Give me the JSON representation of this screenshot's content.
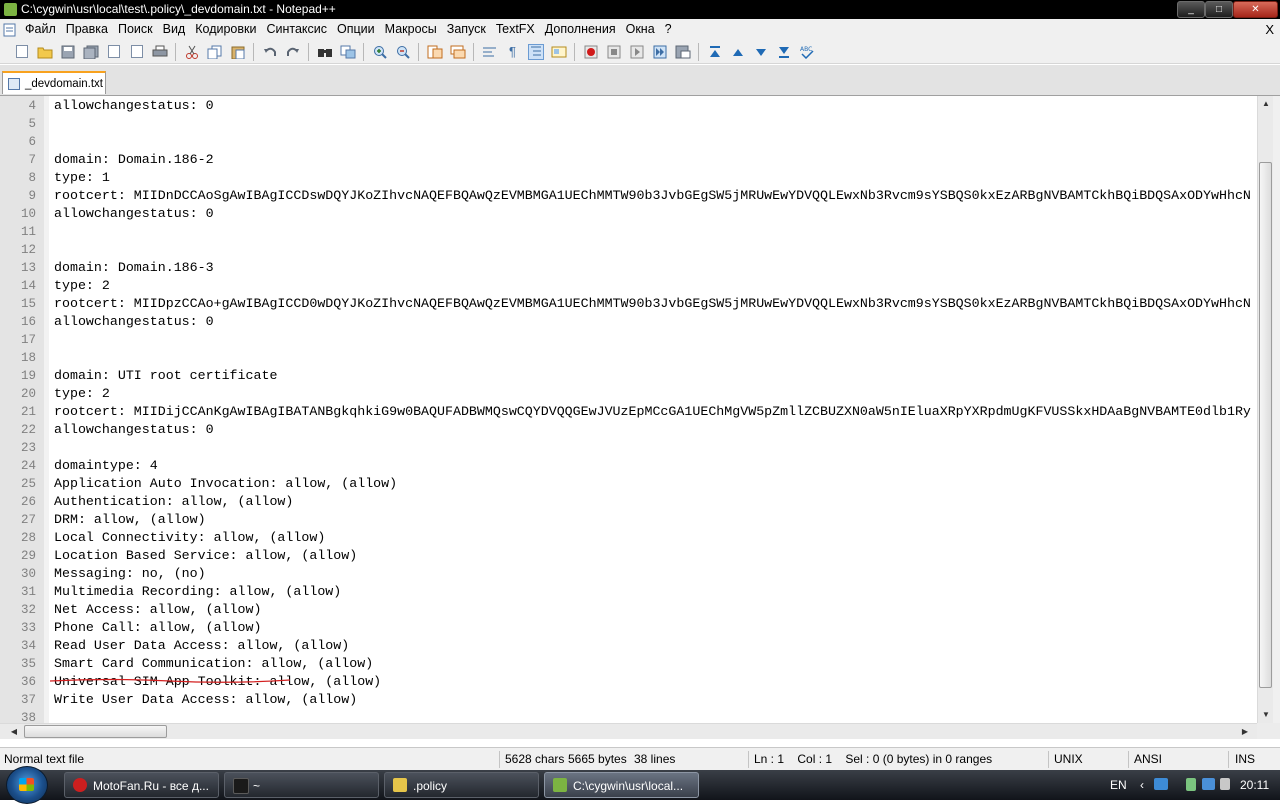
{
  "window": {
    "title": "C:\\cygwin\\usr\\local\\test\\.policy\\_devdomain.txt - Notepad++",
    "controls": [
      "_",
      "□",
      "✕"
    ]
  },
  "menu": {
    "items": [
      "Файл",
      "Правка",
      "Поиск",
      "Вид",
      "Кодировки",
      "Синтаксис",
      "Опции",
      "Макросы",
      "Запуск",
      "TextFX",
      "Дополнения",
      "Окна",
      "?"
    ],
    "close": "X"
  },
  "toolbar": {
    "icons": [
      "new-file-icon",
      "open-file-icon",
      "save-icon",
      "save-all-icon",
      "close-icon",
      "close-all-icon",
      "print-icon",
      "cut-icon",
      "copy-icon",
      "paste-icon",
      "undo-icon",
      "redo-icon",
      "find-icon",
      "replace-icon",
      "zoom-in-icon",
      "zoom-out-icon",
      "sync-vertical-icon",
      "sync-horizontal-icon",
      "word-wrap-icon",
      "show-all-chars-icon",
      "indent-guide-icon",
      "view-doc-icon",
      "record-macro-icon",
      "stop-record-icon",
      "play-macro-icon",
      "run-macro-multiple-icon",
      "save-macro-icon",
      "textfx-first-icon",
      "textfx-up-icon",
      "textfx-down-icon",
      "textfx-last-icon",
      "spellcheck-icon"
    ]
  },
  "tab": {
    "label": "_devdomain.txt"
  },
  "editor": {
    "lines": [
      {
        "n": "4",
        "t": "allowchangestatus: 0"
      },
      {
        "n": "5",
        "t": ""
      },
      {
        "n": "6",
        "t": ""
      },
      {
        "n": "7",
        "t": "domain: Domain.186-2"
      },
      {
        "n": "8",
        "t": "type: 1"
      },
      {
        "n": "9",
        "t": "rootcert: MIIDnDCCAoSgAwIBAgICCDswDQYJKoZIhvcNAQEFBQAwQzEVMBMGA1UEChMMTW90b3JvbGEgSW5jMRUwEwYDVQQLEwxNb3Rvcm9sYSBQS0kxEzARBgNVBAMTCkhBQiBDQSAxODYwHhcN"
      },
      {
        "n": "10",
        "t": "allowchangestatus: 0"
      },
      {
        "n": "11",
        "t": ""
      },
      {
        "n": "12",
        "t": ""
      },
      {
        "n": "13",
        "t": "domain: Domain.186-3"
      },
      {
        "n": "14",
        "t": "type: 2"
      },
      {
        "n": "15",
        "t": "rootcert: MIIDpzCCAo+gAwIBAgICCD0wDQYJKoZIhvcNAQEFBQAwQzEVMBMGA1UEChMMTW90b3JvbGEgSW5jMRUwEwYDVQQLEwxNb3Rvcm9sYSBQS0kxEzARBgNVBAMTCkhBQiBDQSAxODYwHhcN"
      },
      {
        "n": "16",
        "t": "allowchangestatus: 0"
      },
      {
        "n": "17",
        "t": ""
      },
      {
        "n": "18",
        "t": ""
      },
      {
        "n": "19",
        "t": "domain: UTI root certificate"
      },
      {
        "n": "20",
        "t": "type: 2"
      },
      {
        "n": "21",
        "t": "rootcert: MIIDijCCAnKgAwIBAgIBATANBgkqhkiG9w0BAQUFADBWMQswCQYDVQQGEwJVUzEpMCcGA1UEChMgVW5pZmllZCBUZXN0aW5nIEluaXRpYXRpdmUgKFVUSSkxHDAaBgNVBAMTE0dlb1Ry"
      },
      {
        "n": "22",
        "t": "allowchangestatus: 0"
      },
      {
        "n": "23",
        "t": ""
      },
      {
        "n": "24",
        "t": "domaintype: 4"
      },
      {
        "n": "25",
        "t": "Application Auto Invocation: allow, (allow)"
      },
      {
        "n": "26",
        "t": "Authentication: allow, (allow)"
      },
      {
        "n": "27",
        "t": "DRM: allow, (allow)"
      },
      {
        "n": "28",
        "t": "Local Connectivity: allow, (allow)"
      },
      {
        "n": "29",
        "t": "Location Based Service: allow, (allow)"
      },
      {
        "n": "30",
        "t": "Messaging: no, (no)"
      },
      {
        "n": "31",
        "t": "Multimedia Recording: allow, (allow)"
      },
      {
        "n": "32",
        "t": "Net Access: allow, (allow)"
      },
      {
        "n": "33",
        "t": "Phone Call: allow, (allow)"
      },
      {
        "n": "34",
        "t": "Read User Data Access: allow, (allow)"
      },
      {
        "n": "35",
        "t": "Smart Card Communication: allow, (allow)"
      },
      {
        "n": "36",
        "t": "Universal SIM App Toolkit: allow, (allow)"
      },
      {
        "n": "37",
        "t": "Write User Data Access: allow, (allow)"
      },
      {
        "n": "38",
        "t": ""
      }
    ]
  },
  "status": {
    "type": "Normal text file",
    "chars": "5628 chars",
    "bytes": "5665 bytes",
    "lines": "38 lines",
    "position": "Ln : 1    Col : 1    Sel : 0 (0 bytes) in 0 ranges",
    "eol": "UNIX",
    "encoding": "ANSI",
    "mode": "INS"
  },
  "taskbar": {
    "tasks": [
      {
        "label": "MotoFan.Ru - все д...",
        "icon_color": "#cc1f1f"
      },
      {
        "label": "~",
        "icon_color": "#1a1a1a"
      },
      {
        "label": ".policy",
        "icon_color": "#e6c54a"
      },
      {
        "label": "C:\\cygwin\\usr\\local...",
        "icon_color": "#7cb342"
      }
    ],
    "language": "EN",
    "clock": "20:11"
  }
}
